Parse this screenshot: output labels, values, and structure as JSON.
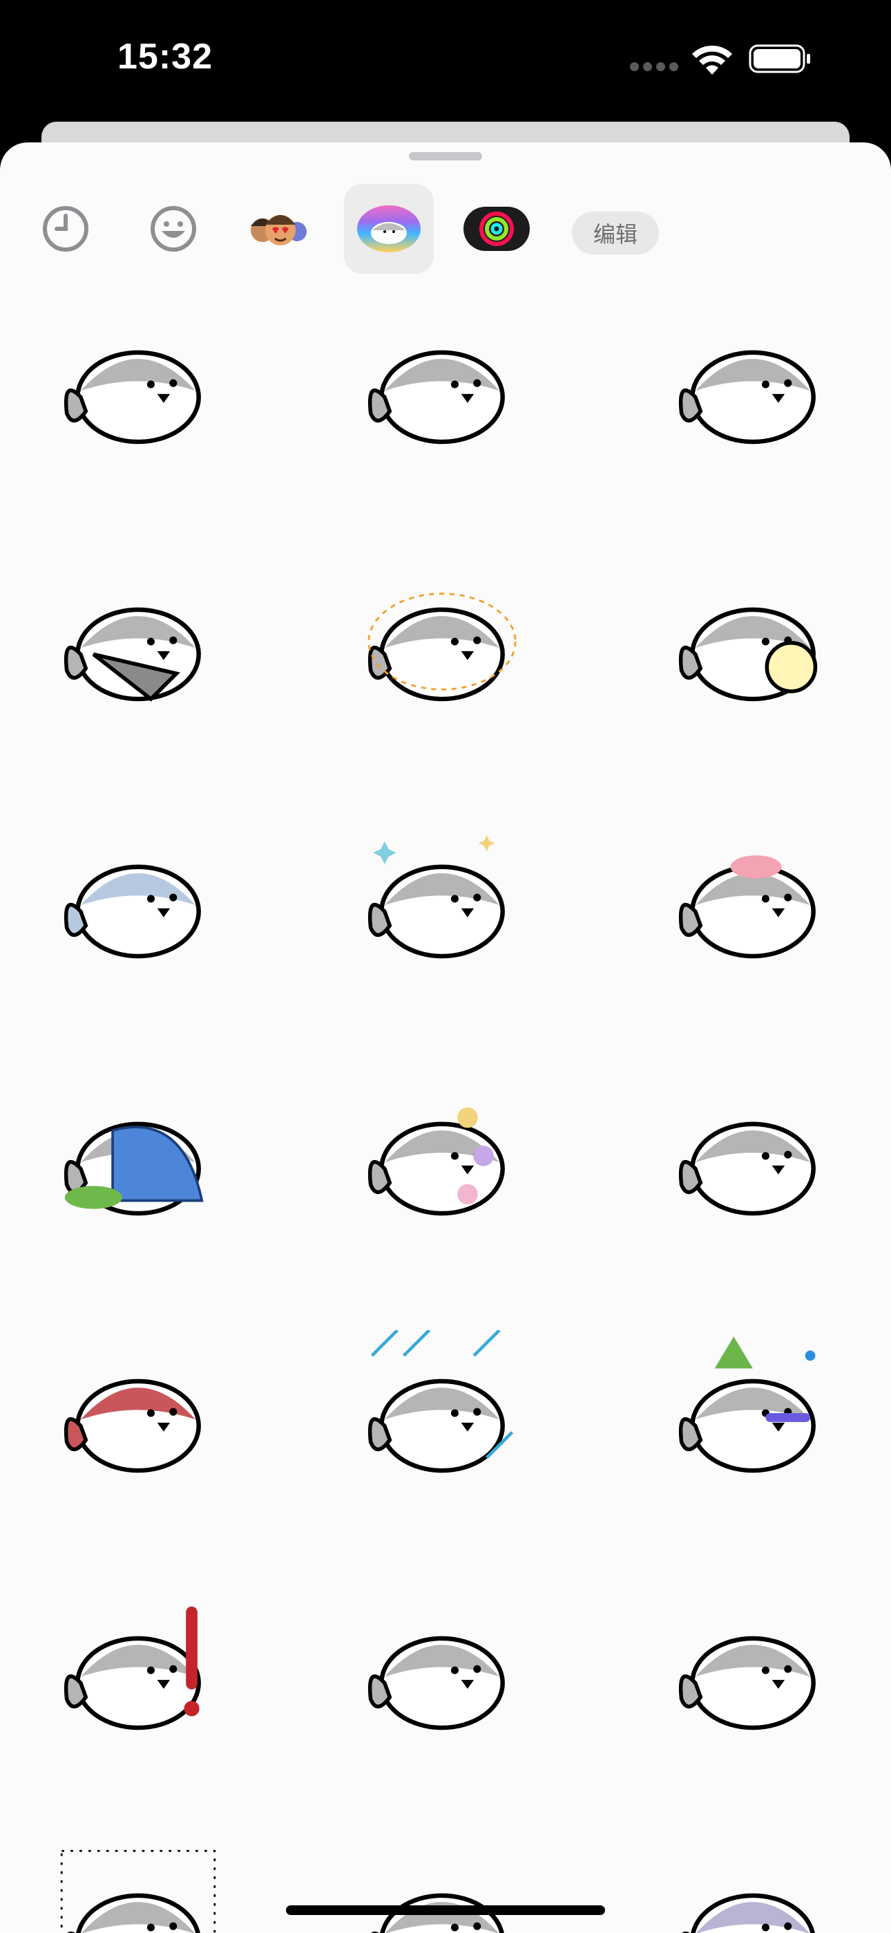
{
  "status": {
    "time": "15:32"
  },
  "tabs": [
    {
      "id": "recent",
      "icon": "clock-icon",
      "active": false
    },
    {
      "id": "emoji",
      "icon": "smiley-icon",
      "active": false
    },
    {
      "id": "memoji",
      "icon": "memoji-icon",
      "active": false
    },
    {
      "id": "seal-stickers",
      "icon": "seal-sticker-pack-icon",
      "active": true
    },
    {
      "id": "activity",
      "icon": "activity-rings-icon",
      "active": false
    }
  ],
  "edit_label": "编辑",
  "stickers": [
    "seal-lying-left",
    "seal-upright-tail-left",
    "seal-lying-right",
    "seal-holding-fish",
    "seal-glowing-outline",
    "seal-with-chick",
    "seal-blue-tilted",
    "seal-sparkles",
    "seal-angry-blush",
    "seal-sleeping-blanket",
    "seal-flowers",
    "seal-plain-oval",
    "seal-red-blush",
    "seal-crying-rain",
    "seal-party-hat",
    "seal-surprised-exclamation",
    "seal-lying-long",
    "seal-lying-shadow",
    "seal-shocked-lines",
    "seal-standing-tall",
    "seal-crying-purple"
  ]
}
